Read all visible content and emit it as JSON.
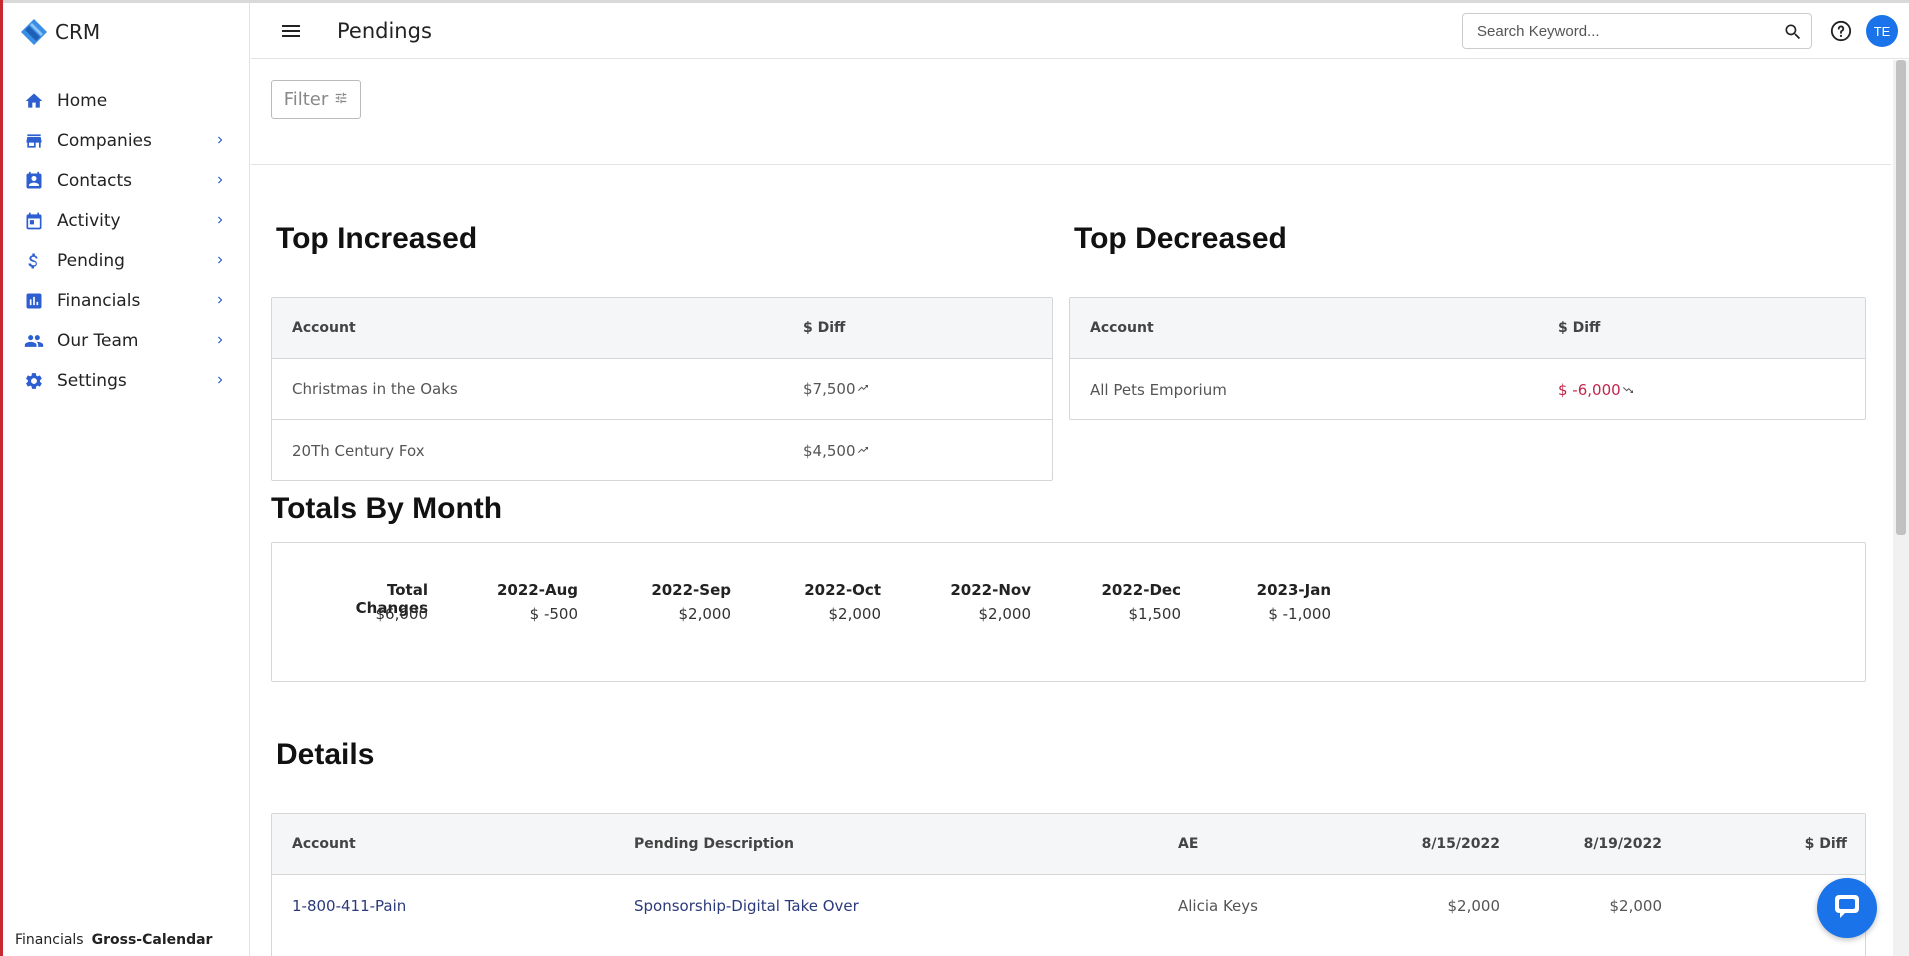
{
  "app": {
    "name": "CRM",
    "page_title": "Pendings"
  },
  "header": {
    "search_placeholder": "Search Keyword...",
    "avatar_initials": "TE"
  },
  "sidebar": {
    "items": [
      {
        "label": "Home",
        "icon": "home-icon"
      },
      {
        "label": "Companies",
        "icon": "store-icon"
      },
      {
        "label": "Contacts",
        "icon": "contact-card-icon"
      },
      {
        "label": "Activity",
        "icon": "calendar-icon"
      },
      {
        "label": "Pending",
        "icon": "dollar-icon"
      },
      {
        "label": "Financials",
        "icon": "bar-chart-icon"
      },
      {
        "label": "Our Team",
        "icon": "people-icon"
      },
      {
        "label": "Settings",
        "icon": "gear-icon"
      }
    ],
    "footer": {
      "section": "Financials",
      "view": "Gross-Calendar"
    }
  },
  "filter": {
    "label": "Filter"
  },
  "top_increased": {
    "title": "Top Increased",
    "columns": [
      "Account",
      "$ Diff"
    ],
    "rows": [
      {
        "account": "Christmas in the Oaks",
        "diff": "$7,500"
      },
      {
        "account": "20Th Century Fox",
        "diff": "$4,500"
      }
    ]
  },
  "top_decreased": {
    "title": "Top Decreased",
    "columns": [
      "Account",
      "$ Diff"
    ],
    "rows": [
      {
        "account": "All Pets Emporium",
        "diff": "$ -6,000"
      }
    ]
  },
  "totals_by_month": {
    "title": "Totals By Month",
    "columns": [
      {
        "label": "Total Changes",
        "value": "$6,000",
        "negative": false
      },
      {
        "label": "2022-Aug",
        "value": "$ -500",
        "negative": true
      },
      {
        "label": "2022-Sep",
        "value": "$2,000",
        "negative": false
      },
      {
        "label": "2022-Oct",
        "value": "$2,000",
        "negative": false
      },
      {
        "label": "2022-Nov",
        "value": "$2,000",
        "negative": false
      },
      {
        "label": "2022-Dec",
        "value": "$1,500",
        "negative": false
      },
      {
        "label": "2023-Jan",
        "value": "$ -1,000",
        "negative": true
      }
    ]
  },
  "details": {
    "title": "Details",
    "columns": [
      "Account",
      "Pending Description",
      "AE",
      "8/15/2022",
      "8/19/2022",
      "$ Diff"
    ],
    "rows": [
      {
        "account": "1-800-411-Pain",
        "description": "Sponsorship-Digital Take Over",
        "ae": "Alicia Keys",
        "d1": "$2,000",
        "d2": "$2,000",
        "diff": ""
      }
    ]
  },
  "colors": {
    "accent": "#1a73e8",
    "icon_blue": "#2d5fd0",
    "negative": "#c0264b"
  }
}
